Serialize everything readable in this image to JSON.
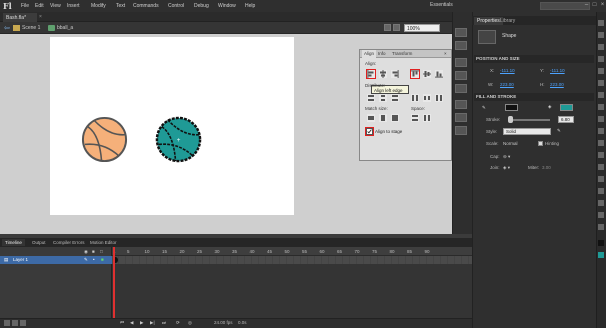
{
  "app": {
    "logo": "Fl",
    "menu": [
      "File",
      "Edit",
      "View",
      "Insert",
      "Modify",
      "Text",
      "Commands",
      "Control",
      "Debug",
      "Window",
      "Help"
    ],
    "workspace": "Essentials"
  },
  "document": {
    "tab_title": "Bash.fla*",
    "close": "×",
    "scene": "Scene 1",
    "symbol": "bball_a",
    "zoom": "100%"
  },
  "align_panel": {
    "tabs": [
      "Align",
      "Info",
      "Transform"
    ],
    "align_label": "Align:",
    "distribute_label": "Distribute:",
    "match_size_label": "Match size:",
    "space_label": "Space:",
    "tooltip": "Align left edge",
    "align_to_stage": "Align to stage"
  },
  "properties": {
    "tabs": [
      "Properties",
      "Library"
    ],
    "shape_label": "Shape",
    "pos_size_header": "POSITION AND SIZE",
    "x_label": "X:",
    "x_value": "-111.10",
    "y_label": "Y:",
    "y_value": "-111.10",
    "w_label": "W:",
    "w_value": "223.00",
    "h_label": "H:",
    "h_value": "223.00",
    "fill_header": "FILL AND STROKE",
    "stroke_label": "Stroke:",
    "stroke_value": "6.80",
    "style_label": "Style:",
    "style_value": "Solid",
    "scale_label": "Scale:",
    "scale_value": "Normal",
    "hinting_label": "Hinting",
    "cap_label": "Cap:",
    "join_label": "Join:",
    "miter_label": "Miter:",
    "miter_value": "3.00",
    "stroke_color": "#111111",
    "fill_color": "#1f9a96"
  },
  "timeline": {
    "tabs": [
      "Timeline",
      "Output",
      "Compiler Errors",
      "Motion Editor"
    ],
    "layer_name": "Layer 1",
    "frame_numbers": [
      "1",
      "5",
      "10",
      "15",
      "20",
      "25",
      "30",
      "35",
      "40",
      "45",
      "50",
      "55",
      "60",
      "65",
      "70",
      "75",
      "80",
      "85",
      "90"
    ],
    "fps": "24.00 fps",
    "time": "0.0s"
  },
  "colors": {
    "ball_orange": "#f5b07a",
    "ball_teal": "#1f9a96",
    "ball_stroke": "#222222",
    "highlight": "#e02020"
  }
}
